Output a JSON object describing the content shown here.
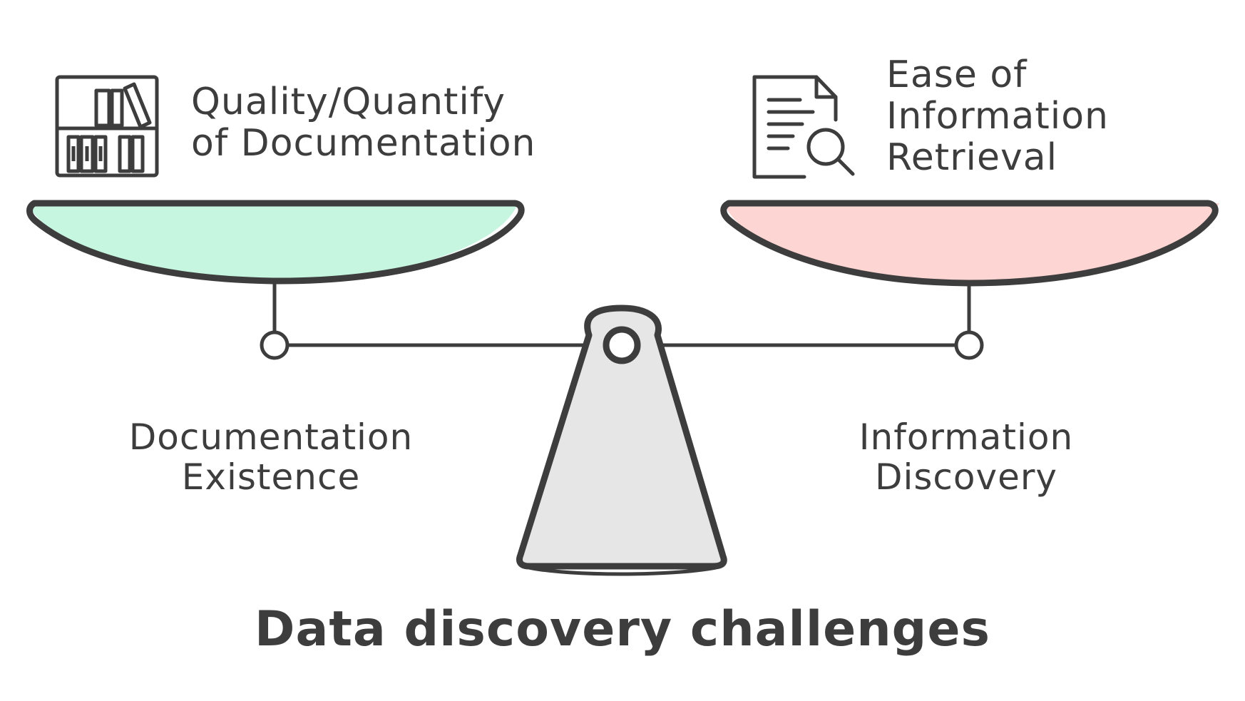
{
  "title": "Data discovery challenges",
  "left_side": {
    "top_label": [
      "Quality/Quantify",
      "of Documentation"
    ],
    "bottom_label": [
      "Documentation",
      "Existence"
    ],
    "icon": "bookshelf-icon",
    "pan_color": "#c6f6e0"
  },
  "right_side": {
    "top_label": [
      "Ease of",
      "Information",
      "Retrieval"
    ],
    "bottom_label": [
      "Information",
      "Discovery"
    ],
    "icon": "document-search-icon",
    "pan_color": "#fdd5d3"
  },
  "colors": {
    "stroke": "#3d3d3d",
    "fulcrum_fill": "#e6e6e6"
  }
}
